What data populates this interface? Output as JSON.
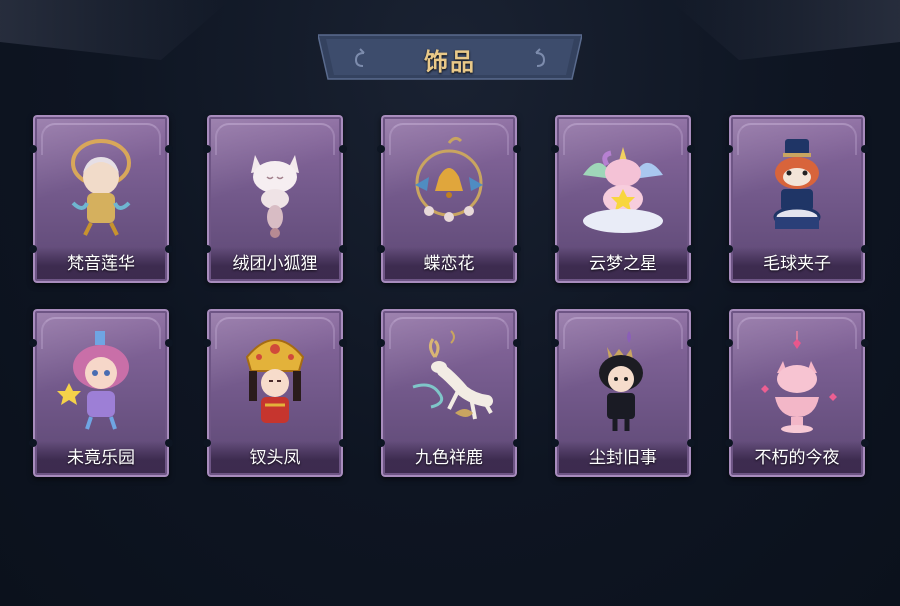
{
  "header": {
    "title": "饰品"
  },
  "items": [
    {
      "name": "梵音莲华",
      "icon": "golden-haired-figure-icon"
    },
    {
      "name": "绒团小狐狸",
      "icon": "white-fox-icon"
    },
    {
      "name": "蝶恋花",
      "icon": "golden-bell-wreath-icon"
    },
    {
      "name": "云梦之星",
      "icon": "unicorn-on-cloud-icon"
    },
    {
      "name": "毛球夹子",
      "icon": "red-panda-drummer-icon"
    },
    {
      "name": "未竟乐园",
      "icon": "pink-haired-girl-icon"
    },
    {
      "name": "钗头凤",
      "icon": "phoenix-crown-bride-icon"
    },
    {
      "name": "九色祥鹿",
      "icon": "white-deer-icon"
    },
    {
      "name": "尘封旧事",
      "icon": "dark-haired-chibi-icon"
    },
    {
      "name": "不朽的今夜",
      "icon": "pink-fox-cup-icon"
    }
  ],
  "colors": {
    "background": "#0d1522",
    "card": "#7a5f92",
    "title_text": "#e9c989",
    "banner": "#3a4a6a"
  }
}
